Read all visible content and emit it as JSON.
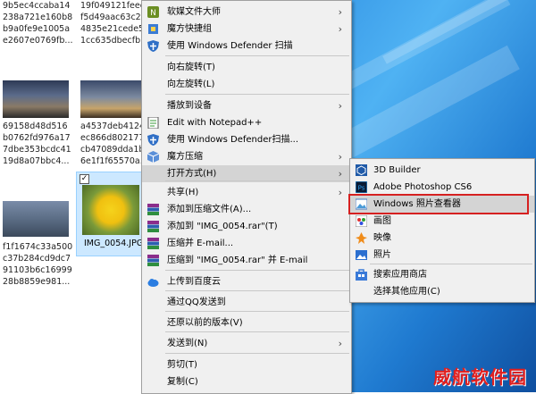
{
  "explorer": {
    "col1_names": [
      [
        "9b5ec4ccaba14",
        "238a721e160b8",
        "b9a0fe9e1005a",
        "e2607e0769fb..."
      ],
      [
        "69158d48d516",
        "b0762fd976a17",
        "7dbe353bcdc41",
        "19d8a07bbc4..."
      ],
      [
        "f1f1674c33a500",
        "c37b284cd9dc7",
        "91103b6c16999",
        "28b8859e981..."
      ]
    ],
    "col2_names": [
      [
        "19f049121feec",
        "f5d49aac63c2",
        "4835e21cede5",
        "1cc635dbecfb..."
      ],
      [
        "a4537deb4124",
        "ec866d802177",
        "cb47089dda1b",
        "6e1f1f65570a..."
      ]
    ],
    "selected_label": "IMG_0054.JPG"
  },
  "context_menu": {
    "items": [
      {
        "label": "软媒文件大师",
        "icon": "file-master-icon",
        "submenu": true
      },
      {
        "label": "魔方快捷组",
        "icon": "cube-shortcut-icon",
        "submenu": true
      },
      {
        "label": "使用 Windows Defender 扫描",
        "icon": "defender-shield-icon",
        "submenu": false
      },
      {
        "label": "向右旋转(T)",
        "icon": "",
        "submenu": false
      },
      {
        "label": "向左旋转(L)",
        "icon": "",
        "submenu": false
      },
      {
        "label": "播放到设备",
        "icon": "",
        "submenu": true
      },
      {
        "label": "Edit with Notepad++",
        "icon": "notepad-plus-icon",
        "submenu": false
      },
      {
        "label": "使用 Windows Defender扫描...",
        "icon": "defender-shield-icon",
        "submenu": false
      },
      {
        "label": "魔方压缩",
        "icon": "cube-compress-icon",
        "submenu": true
      },
      {
        "label": "打开方式(H)",
        "icon": "",
        "submenu": true
      },
      {
        "label": "共享(H)",
        "icon": "",
        "submenu": true
      },
      {
        "label": "添加到压缩文件(A)...",
        "icon": "winrar-icon",
        "submenu": false
      },
      {
        "label": "添加到 \"IMG_0054.rar\"(T)",
        "icon": "winrar-icon",
        "submenu": false
      },
      {
        "label": "压缩并 E-mail...",
        "icon": "winrar-icon",
        "submenu": false
      },
      {
        "label": "压缩到 \"IMG_0054.rar\" 并 E-mail",
        "icon": "winrar-icon",
        "submenu": false
      },
      {
        "label": "上传到百度云",
        "icon": "baidu-cloud-icon",
        "submenu": false
      },
      {
        "label": "通过QQ发送到",
        "icon": "",
        "submenu": false
      },
      {
        "label": "还原以前的版本(V)",
        "icon": "",
        "submenu": false
      },
      {
        "label": "发送到(N)",
        "icon": "",
        "submenu": true
      },
      {
        "label": "剪切(T)",
        "icon": "",
        "submenu": false
      },
      {
        "label": "复制(C)",
        "icon": "",
        "submenu": false
      }
    ]
  },
  "open_with_menu": {
    "items": [
      {
        "label": "3D Builder",
        "icon": "3d-builder-icon"
      },
      {
        "label": "Adobe Photoshop CS6",
        "icon": "photoshop-icon"
      },
      {
        "label": "Windows 照片查看器",
        "icon": "photo-viewer-icon"
      },
      {
        "label": "画图",
        "icon": "paint-icon"
      },
      {
        "label": "映像",
        "icon": "movie-icon"
      },
      {
        "label": "照片",
        "icon": "photos-icon"
      },
      {
        "label": "搜索应用商店",
        "icon": "store-icon"
      },
      {
        "label": "选择其他应用(C)",
        "icon": ""
      }
    ],
    "highlighted_index": 2
  },
  "colors": {
    "highlight_box": "#d62020",
    "menu_bg": "#f0f0f0",
    "watermark": "#e02020"
  },
  "watermark": {
    "text": "威航软件园"
  }
}
